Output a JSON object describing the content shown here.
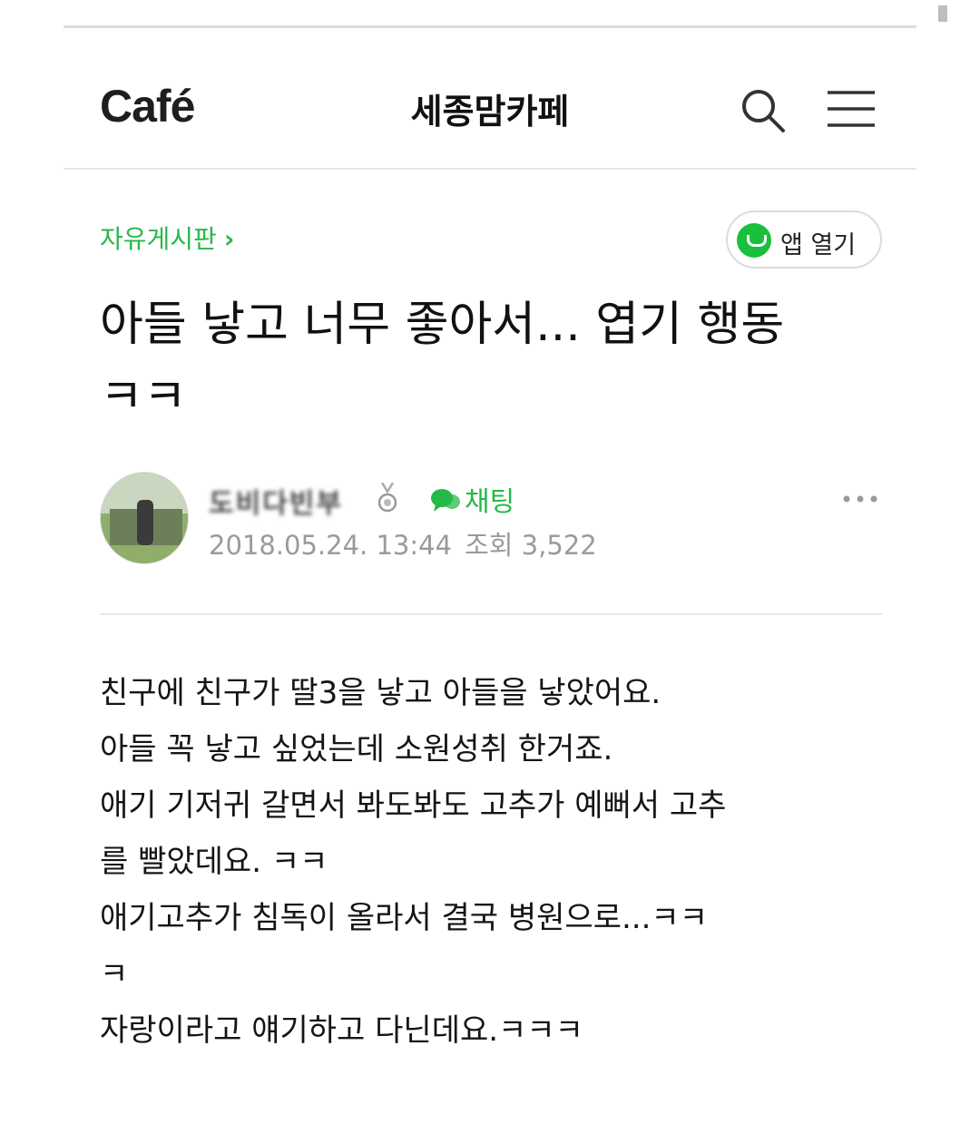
{
  "header": {
    "logo": "Café",
    "cafe_name": "세종맘카페",
    "search_icon": "search-icon",
    "menu_icon": "hamburger-menu-icon"
  },
  "board": {
    "name": "자유게시판",
    "chevron": "›"
  },
  "app_button": {
    "label": "앱 열기",
    "icon": "cafe-app-icon",
    "color": "#19c03b"
  },
  "post": {
    "title_line1": "아들 낳고 너무 좋아서... 엽기 행동",
    "title_line2": "ㅋㅋ",
    "author": {
      "nickname": "도비다빈부",
      "badge_icon": "medal-icon",
      "chat_label": "채팅",
      "chat_icon": "chat-bubble-icon"
    },
    "date": "2018.05.24. 13:44",
    "views_label": "조회",
    "views": "3,522",
    "body_lines": [
      "친구에 친구가 딸3을 낳고 아들을 낳았어요.",
      "아들 꼭 낳고 싶었는데 소원성취 한거죠.",
      "애기 기저귀 갈면서 봐도봐도 고추가 예뻐서 고추",
      "를 빨았데요. ㅋㅋ",
      "애기고추가 침독이 올라서 결국 병원으로...ㅋㅋ",
      "ㅋ",
      "자랑이라고 얘기하고 다닌데요.ㅋㅋㅋ"
    ]
  },
  "colors": {
    "accent_green": "#27b84a",
    "meta_gray": "#9a9a9a"
  }
}
